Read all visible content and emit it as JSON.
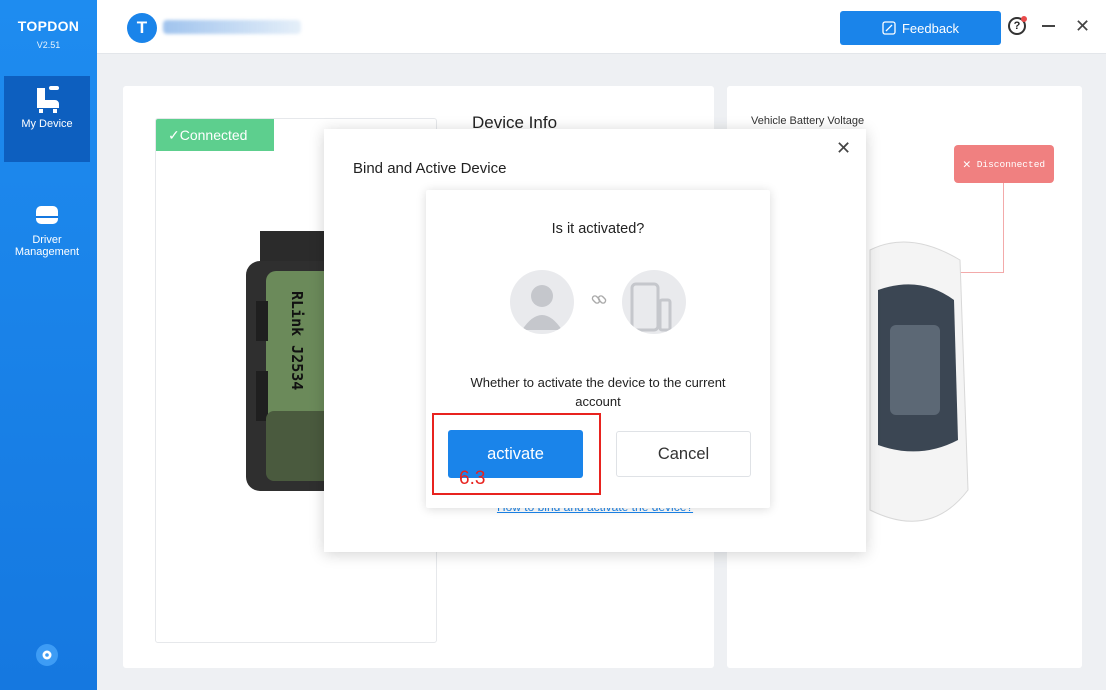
{
  "app": {
    "brand": "TOPDON",
    "version": "V2.51",
    "logo_letter": "T"
  },
  "sidebar": {
    "items": [
      {
        "label": "My Device",
        "icon": "seat-icon",
        "active": true
      },
      {
        "label": "Driver Management",
        "icon": "driver-icon",
        "active": false
      }
    ],
    "settings_icon": "gear-icon"
  },
  "topbar": {
    "feedback_label": "Feedback"
  },
  "device_card": {
    "status": "✓Connected",
    "title": "Device Info",
    "device_text": "RLink J2534"
  },
  "vehicle_card": {
    "voltage_label": "Vehicle Battery Voltage",
    "status": "Disconnected"
  },
  "dialog": {
    "title": "Bind and Active Device",
    "question": "Is it activated?",
    "description": "Whether to activate the device to the current account",
    "activate_label": "activate",
    "cancel_label": "Cancel",
    "help_link": "How to bind and activate the device?"
  },
  "annotation": {
    "label": "6.3",
    "color": "#e8231f"
  },
  "colors": {
    "accent": "#1a84ea",
    "connected": "#5dcf8e",
    "disconnected": "#f08080"
  }
}
